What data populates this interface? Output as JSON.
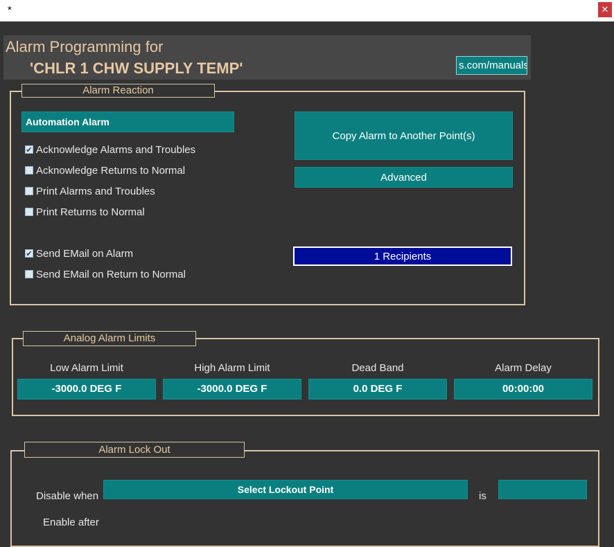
{
  "window": {
    "title": "*",
    "close_glyph": "✕"
  },
  "header": {
    "title_line1": "Alarm Programming for",
    "title_line2": "'CHLR 1 CHW SUPPLY TEMP'",
    "url_text": "s.com/manuals"
  },
  "alarm_reaction": {
    "legend": "Alarm Reaction",
    "alarm_type": "Automation Alarm",
    "copy_button": "Copy Alarm to Another Point(s)",
    "advanced_button": "Advanced",
    "recipients_button": "1 Recipients",
    "checkboxes": [
      {
        "label": "Acknowledge Alarms and Troubles",
        "checked": true
      },
      {
        "label": "Acknowledge Returns to Normal",
        "checked": false
      },
      {
        "label": "Print Alarms and Troubles",
        "checked": false
      },
      {
        "label": "Print Returns to Normal",
        "checked": false
      },
      {
        "label": "Send EMail on Alarm",
        "checked": true
      },
      {
        "label": "Send EMail on Return to Normal",
        "checked": false
      }
    ]
  },
  "analog_limits": {
    "legend": "Analog Alarm Limits",
    "fields": [
      {
        "label": "Low Alarm Limit",
        "value": "-3000.0 DEG F"
      },
      {
        "label": "High Alarm Limit",
        "value": "-3000.0 DEG F"
      },
      {
        "label": "Dead Band",
        "value": "0.0 DEG F"
      },
      {
        "label": "Alarm Delay",
        "value": "00:00:00"
      }
    ]
  },
  "lockout": {
    "legend": "Alarm Lock Out",
    "disable_label": "Disable when",
    "select_button": "Select Lockout Point",
    "is_label": "is",
    "is_value": "",
    "enable_label": "Enable after"
  },
  "colors": {
    "accent_teal": "#0b7f7f",
    "recipients_blue": "#000d99",
    "frame_tan": "#d9c5a7"
  }
}
